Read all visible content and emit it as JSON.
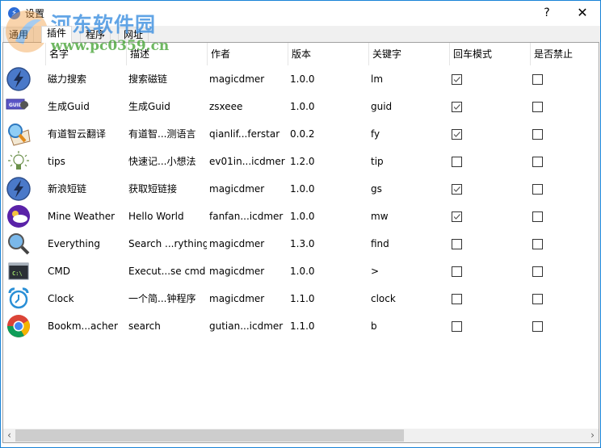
{
  "window": {
    "title": "设置",
    "help_label": "?",
    "close_label": "✕"
  },
  "tabs": [
    {
      "label": "通用",
      "active": false
    },
    {
      "label": "插件",
      "active": true
    },
    {
      "label": "程序",
      "active": false
    },
    {
      "label": "网址",
      "active": false
    }
  ],
  "table": {
    "columns": [
      "名字",
      "描述",
      "作者",
      "版本",
      "关键字",
      "回车模式",
      "是否禁止"
    ],
    "rows": [
      {
        "icon": "lightning-icon",
        "name": "磁力搜索",
        "desc": "搜索磁链",
        "author": "magicdmer",
        "version": "1.0.0",
        "keyword": "lm",
        "enter_mode": true,
        "disabled": false
      },
      {
        "icon": "guid-wrench-icon",
        "name": "生成Guid",
        "desc": "生成Guid",
        "author": "zsxeee",
        "version": "1.0.0",
        "keyword": "guid",
        "enter_mode": true,
        "disabled": false
      },
      {
        "icon": "dictionary-search-icon",
        "name": "有道智云翻译",
        "desc": "有道智...测语言",
        "author": "qianlif...ferstar",
        "version": "0.0.2",
        "keyword": "fy",
        "enter_mode": true,
        "disabled": false
      },
      {
        "icon": "lightbulb-icon",
        "name": "tips",
        "desc": "快速记...小想法",
        "author": "ev01in...icdmer",
        "version": "1.2.0",
        "keyword": "tip",
        "enter_mode": false,
        "disabled": false
      },
      {
        "icon": "lightning-icon",
        "name": "新浪短链",
        "desc": "获取短链接",
        "author": "magicdmer",
        "version": "1.0.0",
        "keyword": "gs",
        "enter_mode": true,
        "disabled": false
      },
      {
        "icon": "weather-icon",
        "name": "Mine Weather",
        "desc": "Hello World",
        "author": "fanfan...icdmer",
        "version": "1.0.0",
        "keyword": "mw",
        "enter_mode": true,
        "disabled": false
      },
      {
        "icon": "magnifier-icon",
        "name": "Everything",
        "desc": "Search ...rything",
        "author": "magicdmer",
        "version": "1.3.0",
        "keyword": "find",
        "enter_mode": false,
        "disabled": false
      },
      {
        "icon": "terminal-icon",
        "name": "CMD",
        "desc": "Execut...se cmd",
        "author": "magicdmer",
        "version": "1.0.0",
        "keyword": ">",
        "enter_mode": false,
        "disabled": false
      },
      {
        "icon": "alarm-clock-icon",
        "name": "Clock",
        "desc": "一个简...钟程序",
        "author": "magicdmer",
        "version": "1.1.0",
        "keyword": "clock",
        "enter_mode": false,
        "disabled": false
      },
      {
        "icon": "chrome-icon",
        "name": "Bookm...acher",
        "desc": "search",
        "author": "gutian...icdmer",
        "version": "1.1.0",
        "keyword": "b",
        "enter_mode": false,
        "disabled": false
      }
    ]
  },
  "scrollbar": {
    "left_arrow": "‹",
    "right_arrow": "›"
  },
  "watermark": {
    "name": "河东软件园",
    "url": "www.pc0359.cn"
  },
  "colors": {
    "window_border": "#1883d7",
    "tab_bg": "#f0f0f0",
    "scroll_thumb": "#cdcdcd"
  }
}
